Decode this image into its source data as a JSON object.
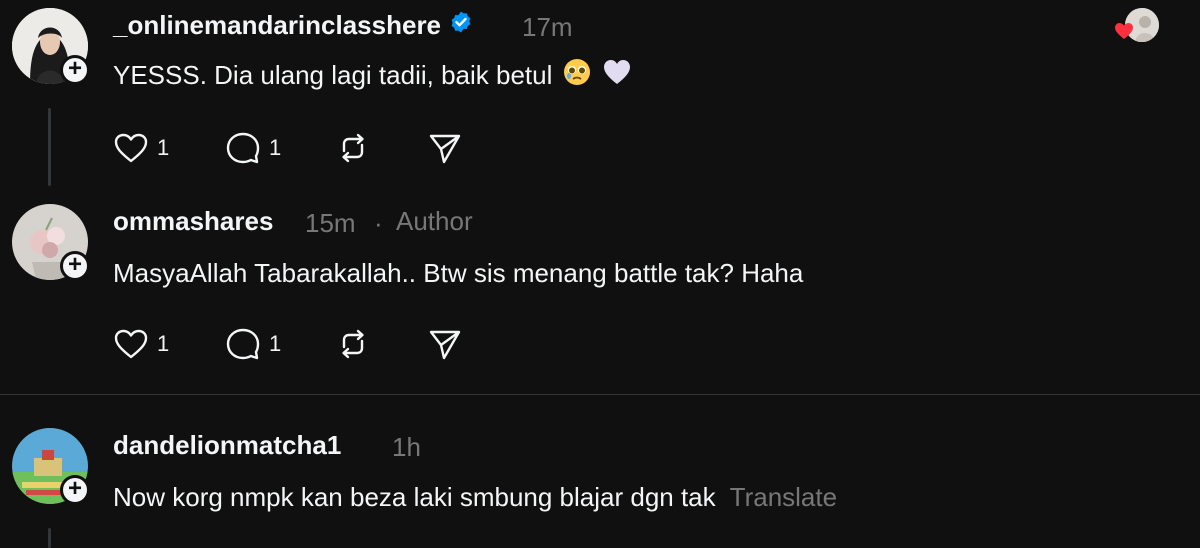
{
  "posts": [
    {
      "username": "_onlinemandarinclasshere",
      "verified": true,
      "time": "17m",
      "text": "YESSS. Dia ulang lagi tadii, baik betul",
      "emojis": [
        "pleading-face-emoji",
        "white-heart-emoji"
      ],
      "likes": "1",
      "replies": "1"
    },
    {
      "username": "ommashares",
      "time": "15m",
      "separator": "·",
      "author_label": "Author",
      "text": "MasyaAllah Tabarakallah.. Btw sis menang battle tak? Haha",
      "likes": "1",
      "replies": "1"
    },
    {
      "username": "dandelionmatcha1",
      "time": "1h",
      "text": "Now korg nmpk kan beza laki smbung blajar dgn tak",
      "translate_label": "Translate"
    }
  ],
  "colors": {
    "background": "#101010",
    "text": "#f3f5f7",
    "muted": "#777777",
    "verified": "#0095f6",
    "divider": "#333638",
    "heart": "#ff3040"
  },
  "icons": [
    "heart-icon",
    "comment-icon",
    "repost-icon",
    "share-icon",
    "verified-badge-icon",
    "follow-plus-icon",
    "liked-by-author-avatar"
  ]
}
